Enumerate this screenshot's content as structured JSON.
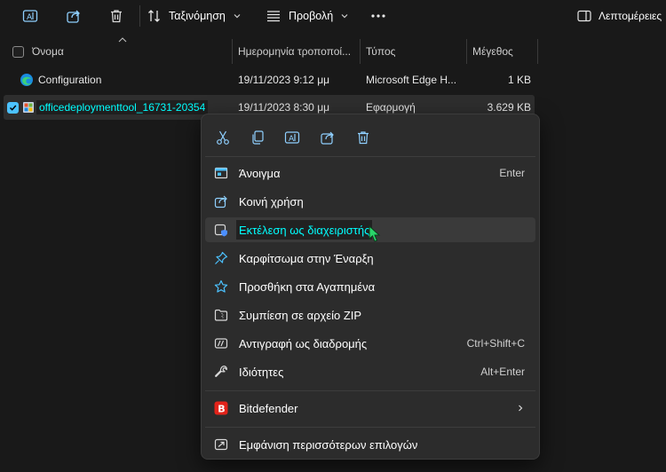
{
  "toolbar": {
    "sort_label": "Ταξινόμηση",
    "view_label": "Προβολή",
    "details_label": "Λεπτομέρειες"
  },
  "columns": {
    "name": "Όνομα",
    "date": "Ημερομηνία τροποποί...",
    "type": "Τύπος",
    "size": "Μέγεθος"
  },
  "files": [
    {
      "name": "Configuration",
      "date": "19/11/2023 9:12 μμ",
      "type": "Microsoft Edge H...",
      "size": "1 KB"
    },
    {
      "name": "officedeploymenttool_16731-20354",
      "date": "19/11/2023 8:30 μμ",
      "type": "Εφαρμογή",
      "size": "3.629 KB"
    }
  ],
  "context_menu": {
    "items": [
      {
        "label": "Άνοιγμα",
        "shortcut": "Enter"
      },
      {
        "label": "Κοινή χρήση",
        "shortcut": ""
      },
      {
        "label": "Εκτέλεση ως διαχειριστής",
        "shortcut": ""
      },
      {
        "label": "Καρφίτσωμα στην Έναρξη",
        "shortcut": ""
      },
      {
        "label": "Προσθήκη στα Αγαπημένα",
        "shortcut": ""
      },
      {
        "label": "Συμπίεση σε αρχείο ZIP",
        "shortcut": ""
      },
      {
        "label": "Αντιγραφή ως διαδρομής",
        "shortcut": "Ctrl+Shift+C"
      },
      {
        "label": "Ιδιότητες",
        "shortcut": "Alt+Enter"
      },
      {
        "label": "Bitdefender",
        "shortcut": ""
      },
      {
        "label": "Εμφάνιση περισσότερων επιλογών",
        "shortcut": ""
      }
    ]
  },
  "colors": {
    "background": "#191919",
    "menu_background": "#2c2c2c",
    "accent": "#4cc2ff",
    "highlight_text": "#00ffff",
    "bitdefender_red": "#e2231a"
  }
}
